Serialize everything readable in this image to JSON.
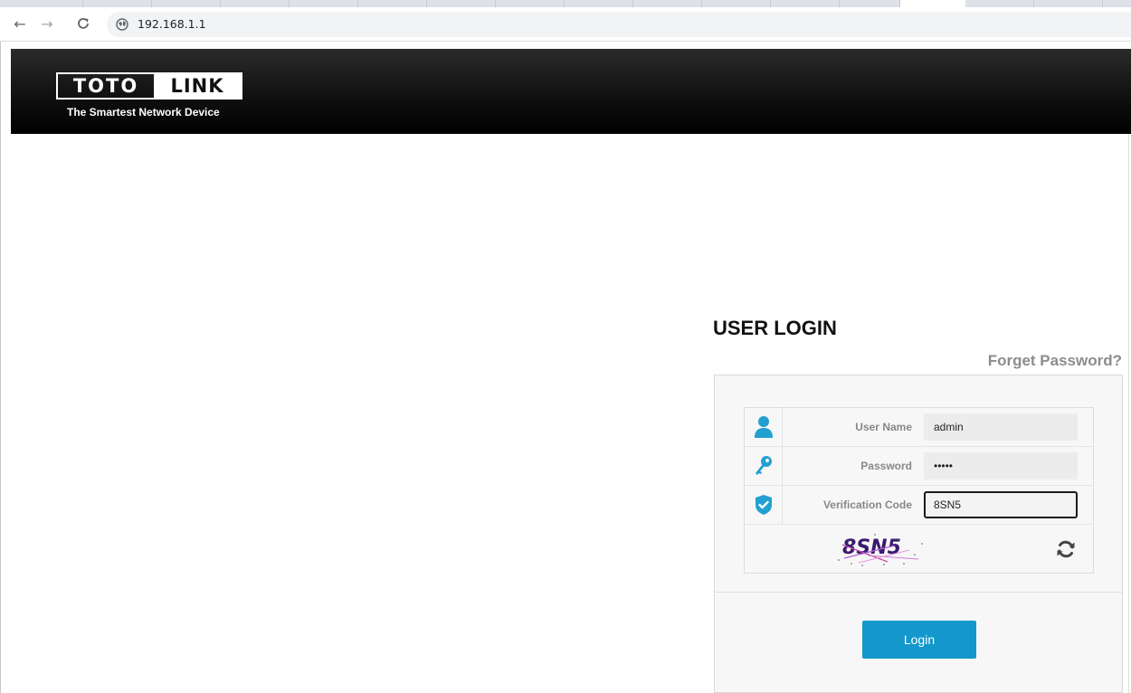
{
  "browser": {
    "url": "192.168.1.1"
  },
  "brand": {
    "logo_left": "TOTO",
    "logo_right": "LINK",
    "tagline": "The Smartest Network Device"
  },
  "login": {
    "title": "USER LOGIN",
    "forget_password": "Forget Password?",
    "fields": [
      {
        "label": "User Name",
        "value": "admin",
        "icon": "user-icon"
      },
      {
        "label": "Password",
        "value": "•••••",
        "icon": "key-icon"
      },
      {
        "label": "Verification Code",
        "value": "8SN5",
        "icon": "shield-check-icon"
      }
    ],
    "captcha_text": "8SN5",
    "login_button": "Login"
  },
  "colors": {
    "accent": "#1397cc",
    "icon": "#22a0d0",
    "header_bg": "#000000"
  }
}
